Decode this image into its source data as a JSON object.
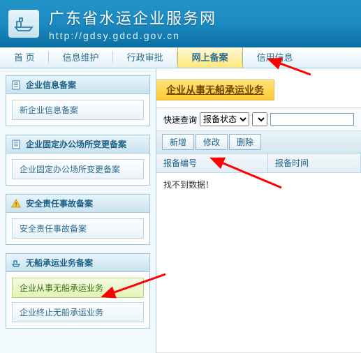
{
  "header": {
    "title": "广东省水运企业服务网",
    "url": "http://gdsy.gdcd.gov.cn"
  },
  "nav": {
    "items": [
      {
        "label": "首 页",
        "active": false
      },
      {
        "label": "信息维护",
        "active": false
      },
      {
        "label": "行政审批",
        "active": false
      },
      {
        "label": "网上备案",
        "active": true
      },
      {
        "label": "信用信息",
        "active": false
      }
    ]
  },
  "sidebar": {
    "panels": [
      {
        "title": "企业信息备案",
        "icon": "doc",
        "items": [
          {
            "label": "新企业信息备案",
            "highlight": false
          }
        ]
      },
      {
        "title": "企业固定办公场所变更备案",
        "icon": "doc",
        "items": [
          {
            "label": "企业固定办公场所变更备案",
            "highlight": false
          }
        ]
      },
      {
        "title": "安全责任事故备案",
        "icon": "warn",
        "items": [
          {
            "label": "安全责任事故备案",
            "highlight": false
          }
        ]
      },
      {
        "title": "无船承运业务备案",
        "icon": "ship",
        "items": [
          {
            "label": "企业从事无船承运业务",
            "highlight": true
          },
          {
            "label": "企业终止无船承运业务",
            "highlight": false
          }
        ]
      }
    ]
  },
  "main": {
    "title": "企业从事无船承运业务",
    "query_label": "快速查询",
    "query_select": "报备状态",
    "query_value": "",
    "buttons": {
      "add": "新增",
      "edit": "修改",
      "delete": "删除"
    },
    "columns": {
      "c1": "报备编号",
      "c2": "报备时间"
    },
    "empty": "找不到数据！"
  }
}
